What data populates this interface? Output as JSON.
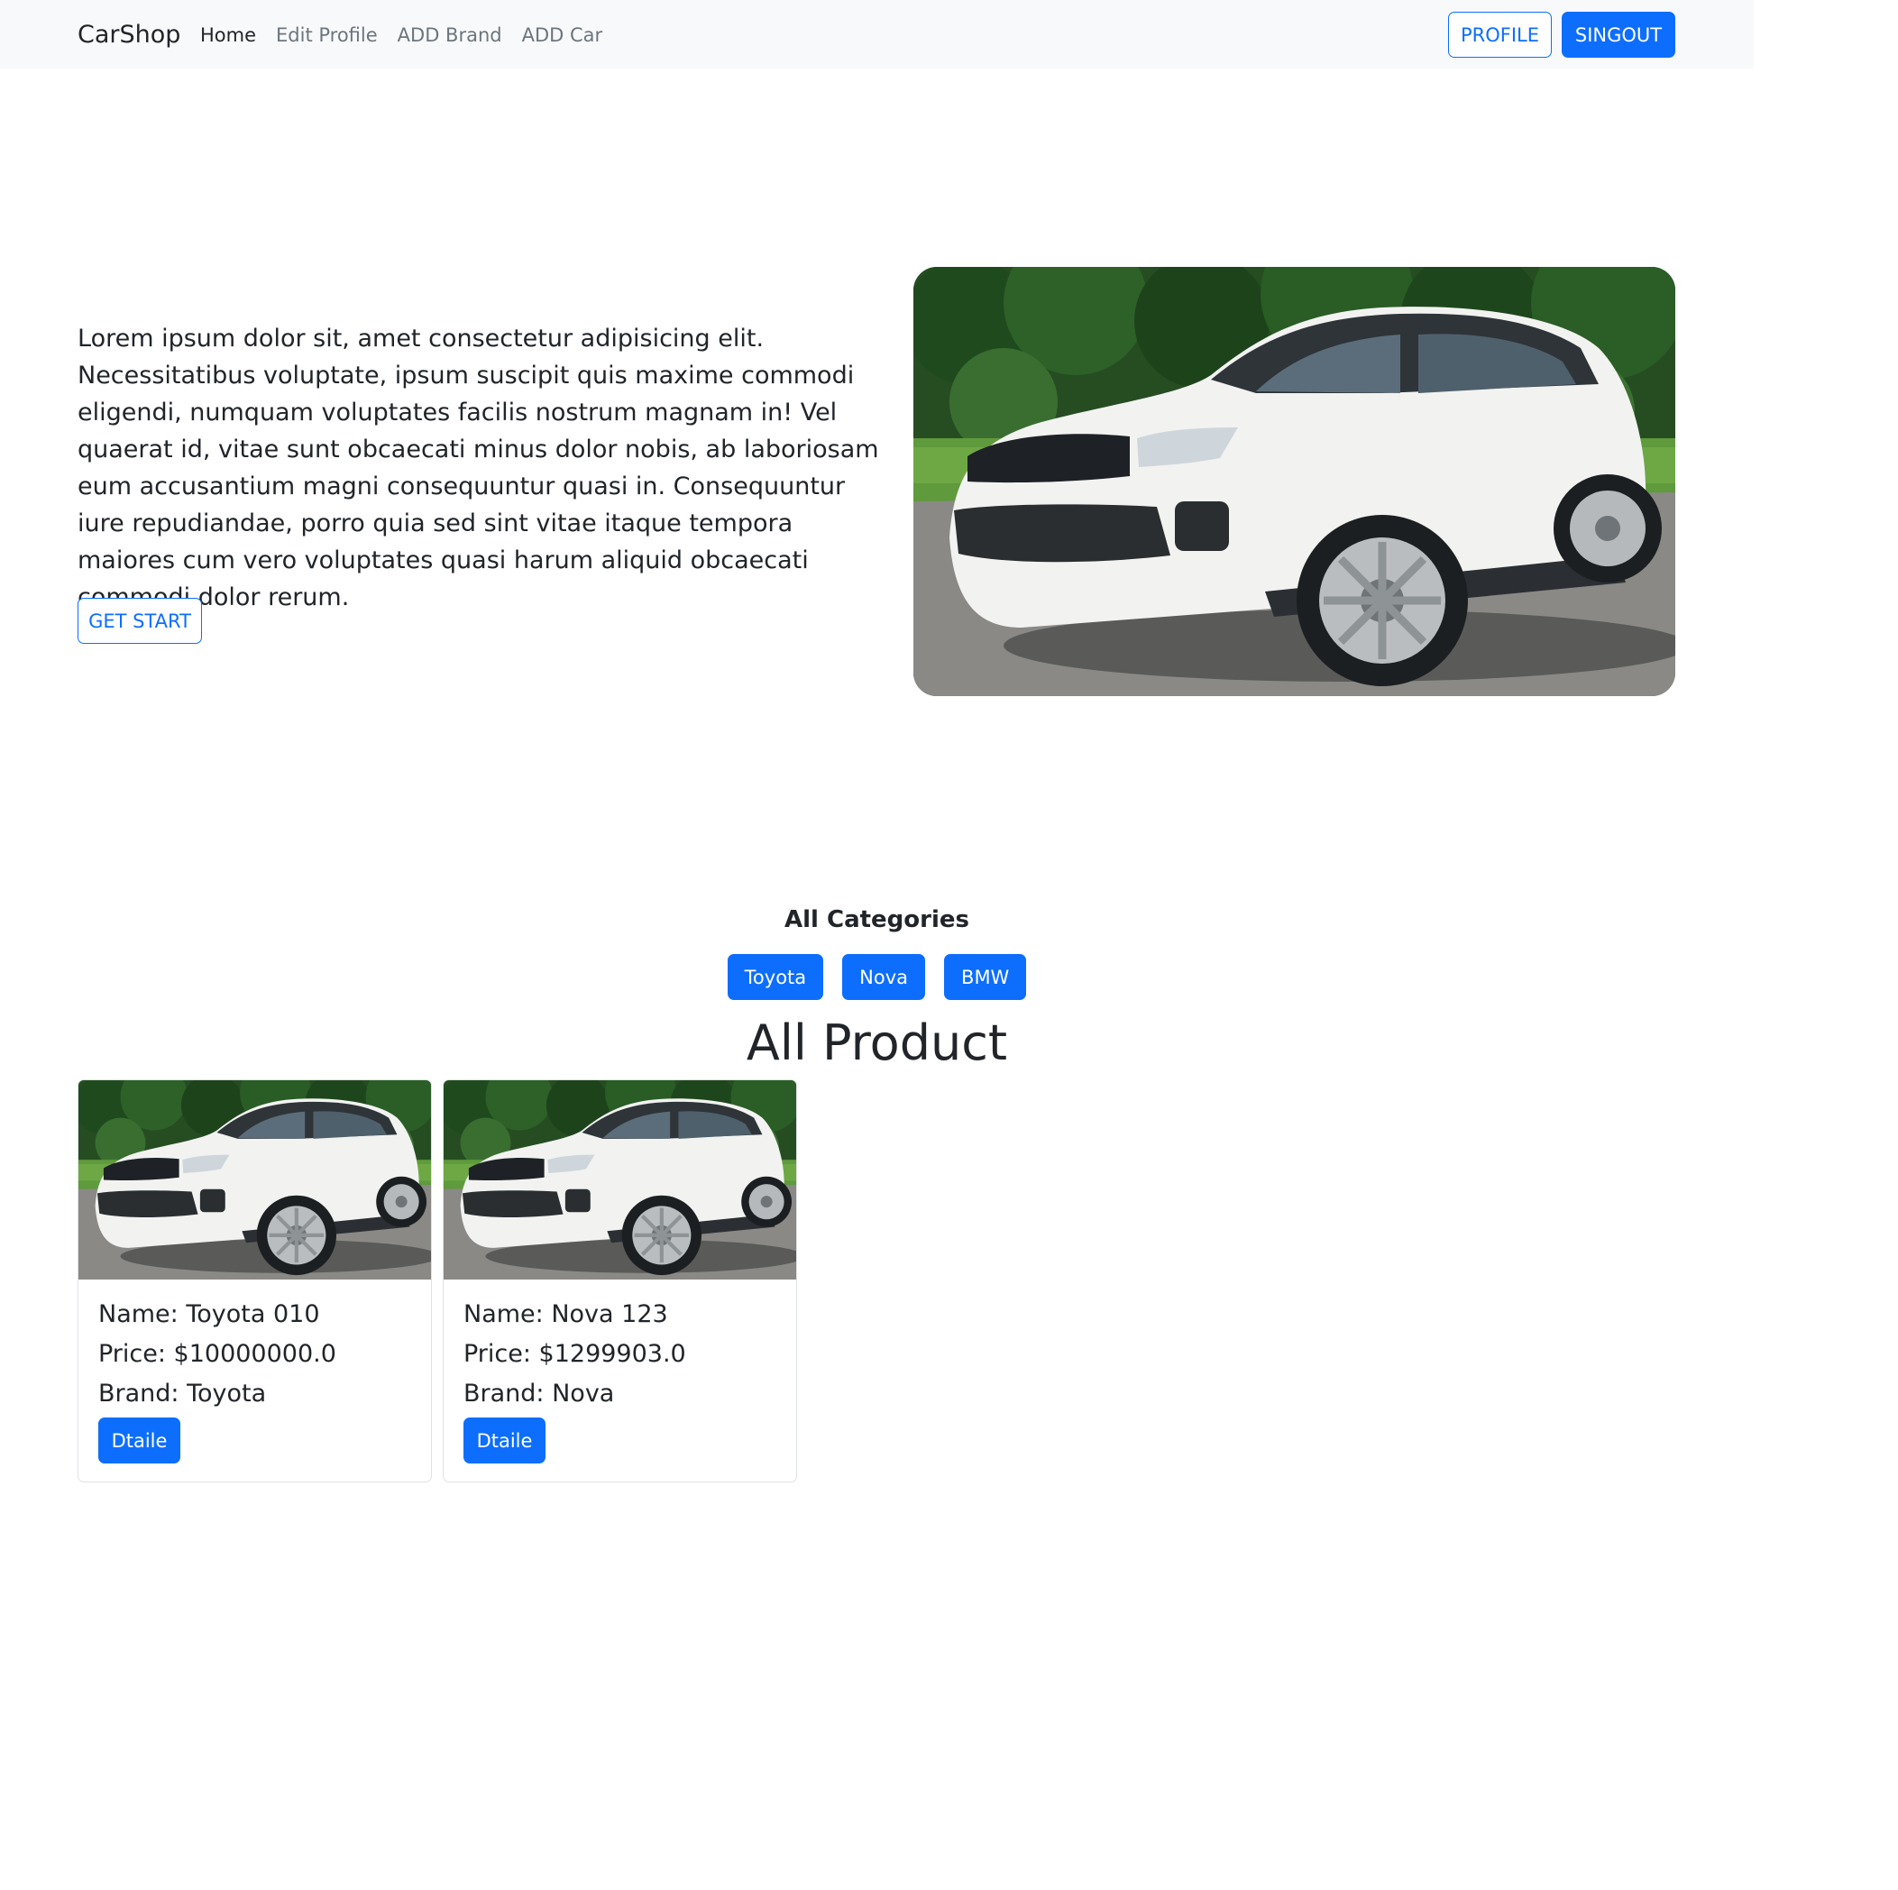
{
  "navbar": {
    "brand": "CarShop",
    "links": [
      "Home",
      "Edit Profile",
      "ADD Brand",
      "ADD Car"
    ],
    "profile_label": "PROFILE",
    "signout_label": "SINGOUT"
  },
  "hero": {
    "text": "Lorem ipsum dolor sit, amet consectetur adipisicing elit. Necessitatibus voluptate, ipsum suscipit quis maxime commodi eligendi, numquam voluptates facilis nostrum magnam in! Vel quaerat id, vitae sunt obcaecati minus dolor nobis, ab laboriosam eum accusantium magni consequuntur quasi in. Consequuntur iure repudiandae, porro quia sed sint vitae itaque tempora maiores cum vero voluptates quasi harum aliquid obcaecati commodi dolor rerum.",
    "button_label": "GET START"
  },
  "categories": {
    "title": "All Categories",
    "items": [
      "Toyota",
      "Nova",
      "BMW"
    ]
  },
  "products": {
    "title": "All Product",
    "items": [
      {
        "name": "Name: Toyota 010",
        "price": "Price: $10000000.0",
        "brand": "Brand: Toyota",
        "button": "Dtaile"
      },
      {
        "name": "Name: Nova 123",
        "price": "Price: $1299903.0",
        "brand": "Brand: Nova",
        "button": "Dtaile"
      }
    ]
  },
  "colors": {
    "primary": "#0d6efd",
    "navbar_bg": "#f8f9fa",
    "text": "#212529",
    "muted": "#6c757d"
  }
}
